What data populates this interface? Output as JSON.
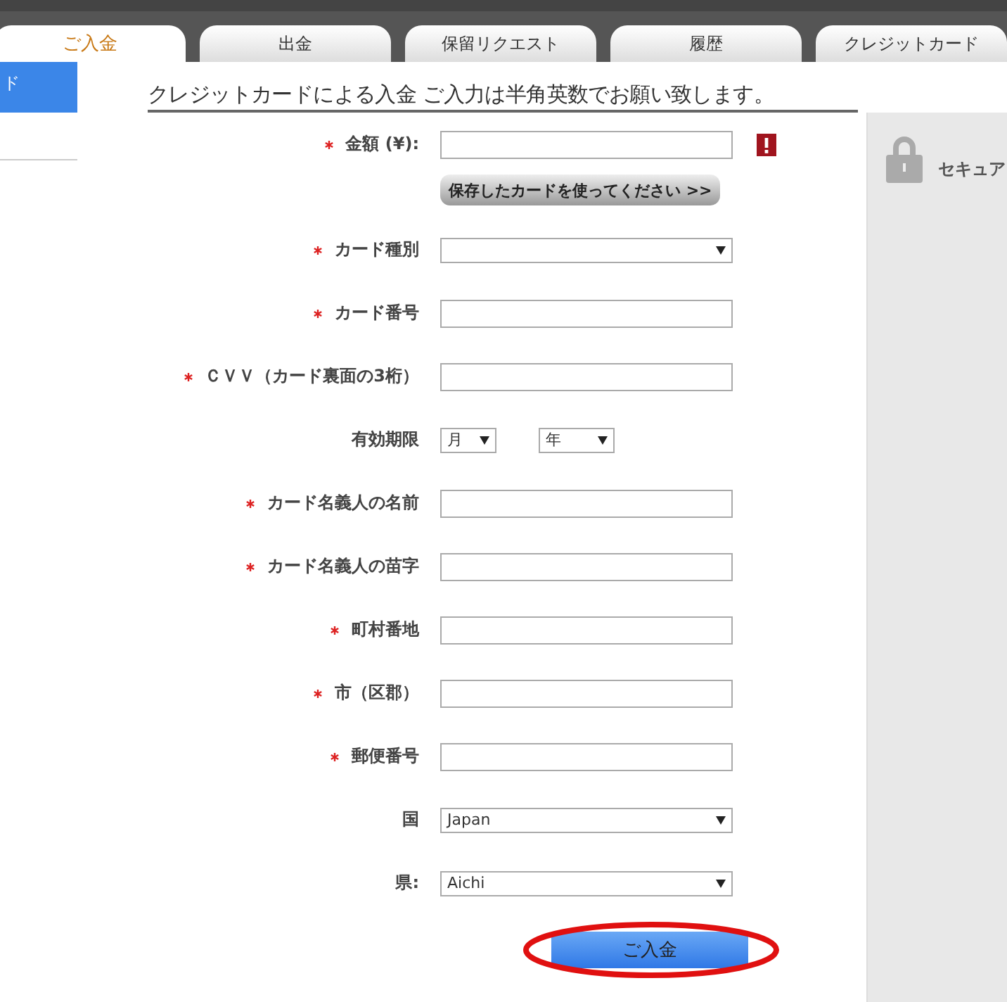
{
  "tabs": [
    {
      "label": "ご入金",
      "selected": true
    },
    {
      "label": "出金",
      "selected": false
    },
    {
      "label": "保留リクエスト",
      "selected": false
    },
    {
      "label": "履歴",
      "selected": false
    },
    {
      "label": "クレジットカード",
      "selected": false
    }
  ],
  "sidebar": {
    "items": [
      {
        "label": "ド",
        "selected": true
      }
    ]
  },
  "form": {
    "title": "クレジットカードによる入金 ご入力は半角英数でお願い致します。",
    "saved_card_button": "保存したカードを使ってください >>",
    "fields": [
      {
        "kind": "text",
        "label": "金額 (¥):",
        "required": true,
        "error": true
      },
      {
        "kind": "button"
      },
      {
        "kind": "select",
        "label": "カード種別",
        "required": true
      },
      {
        "kind": "text",
        "label": "カード番号",
        "required": true
      },
      {
        "kind": "text",
        "label": "ＣＶＶ（カード裏面の3桁）",
        "required": true
      },
      {
        "kind": "date",
        "label": "有効期限",
        "required": false,
        "month": "月",
        "year": "年"
      },
      {
        "kind": "text",
        "label": "カード名義人の名前",
        "required": true
      },
      {
        "kind": "text",
        "label": "カード名義人の苗字",
        "required": true
      },
      {
        "kind": "text",
        "label": "町村番地",
        "required": true
      },
      {
        "kind": "text",
        "label": "市（区郡）",
        "required": true
      },
      {
        "kind": "text",
        "label": "郵便番号",
        "required": true
      },
      {
        "kind": "select",
        "label": "国",
        "required": false,
        "value": "Japan"
      },
      {
        "kind": "select",
        "label": "県:",
        "required": false,
        "value": "Aichi"
      }
    ],
    "submit": "ご入金"
  },
  "secure_panel": {
    "label": "セキュア"
  }
}
